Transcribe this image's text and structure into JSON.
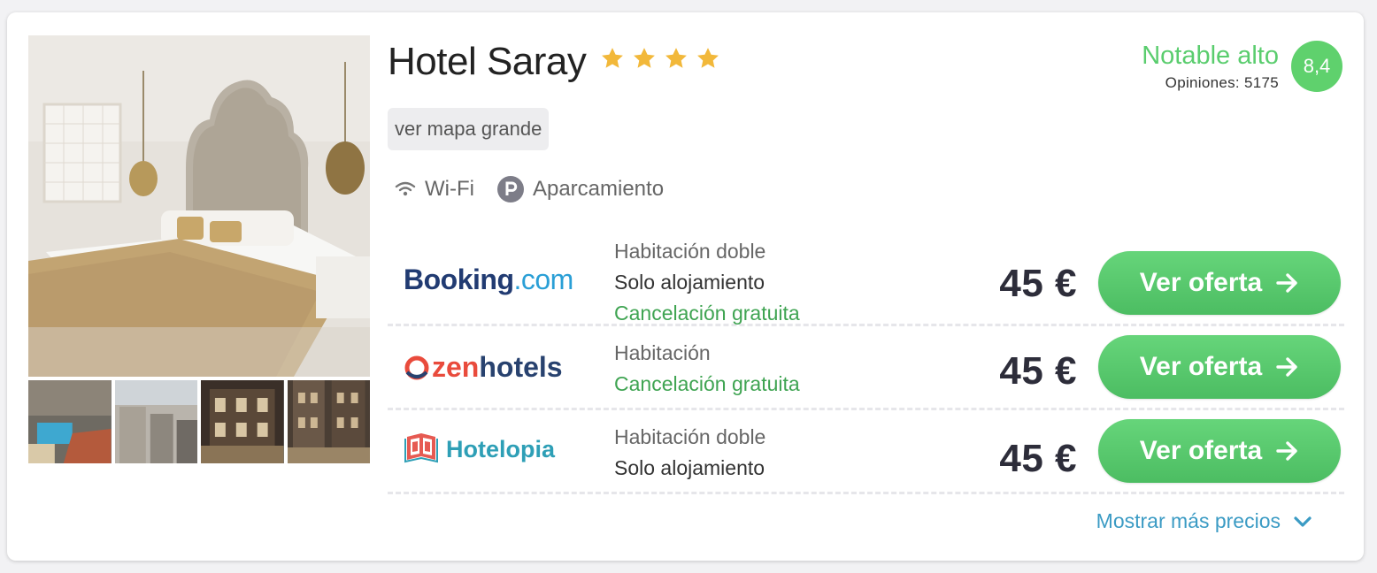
{
  "hotel": {
    "name": "Hotel Saray",
    "stars": 4,
    "map_label": "ver mapa grande"
  },
  "rating": {
    "label": "Notable alto",
    "opinions": "Opiniones: 5175",
    "score": "8,4"
  },
  "amenities": [
    {
      "icon": "wifi-icon",
      "label": "Wi-Fi"
    },
    {
      "icon": "parking-icon",
      "label": "Aparcamiento"
    }
  ],
  "offers": [
    {
      "provider": "Booking.com",
      "logo_parts": [
        "Booking",
        ".com"
      ],
      "room": "Habitación doble",
      "board": "Solo alojamiento",
      "cancellation": "Cancelación gratuita",
      "price": "45 €",
      "cta": "Ver oferta"
    },
    {
      "provider": "zenhotels",
      "logo_parts": [
        "zen",
        "hotels"
      ],
      "room": "Habitación",
      "cancellation": "Cancelación gratuita",
      "price": "45 €",
      "cta": "Ver oferta"
    },
    {
      "provider": "Hotelopia",
      "logo_parts": [
        "Hotelopia"
      ],
      "room": "Habitación doble",
      "board": "Solo alojamiento",
      "price": "45 €",
      "cta": "Ver oferta"
    }
  ],
  "more_prices": "Mostrar más precios",
  "colors": {
    "rating_green": "#5acd6e",
    "cta_green": "#56c66b",
    "cancel_green": "#3fa452",
    "star_gold": "#f2b83a",
    "link_blue": "#3b9bc4",
    "booking_navy": "#213b72",
    "booking_light": "#2a9fd6",
    "zen_red": "#e94b3c",
    "zen_navy": "#28426f",
    "hotelopia_teal": "#2e9fb6"
  }
}
